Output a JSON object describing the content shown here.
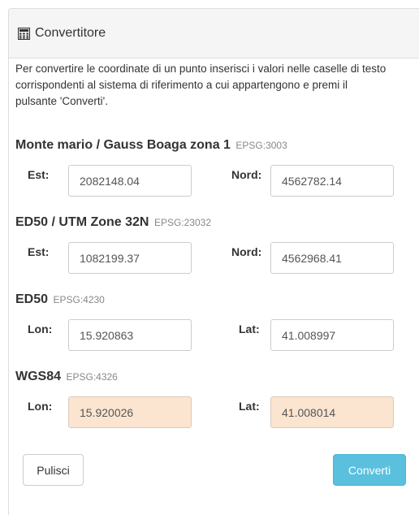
{
  "panel": {
    "title": "Convertitore",
    "icon": "calculator-icon"
  },
  "intro": "Per convertire le coordinate di un punto inserisci i valori nelle caselle di testo corrispondenti al sistema di riferimento a cui appartengono e premi il pulsante 'Converti'.",
  "groups": [
    {
      "name": "Monte mario / Gauss Boaga zona 1",
      "epsg": "EPSG:3003",
      "label1": "Est:",
      "value1": "2082148.04",
      "label2": "Nord:",
      "value2": "4562782.14"
    },
    {
      "name": "ED50 / UTM Zone 32N",
      "epsg": "EPSG:23032",
      "label1": "Est:",
      "value1": "1082199.37",
      "label2": "Nord:",
      "value2": "4562968.41"
    },
    {
      "name": "ED50",
      "epsg": "EPSG:4230",
      "label1": "Lon:",
      "value1": "15.920863",
      "label2": "Lat:",
      "value2": "41.008997"
    },
    {
      "name": "WGS84",
      "epsg": "EPSG:4326",
      "label1": "Lon:",
      "value1": "15.920026",
      "label2": "Lat:",
      "value2": "41.008014"
    }
  ],
  "buttons": {
    "clear": "Pulisci",
    "convert": "Converti"
  },
  "colors": {
    "readonly_field": "#fbe5d0",
    "convert_button": "#5bc0de"
  }
}
